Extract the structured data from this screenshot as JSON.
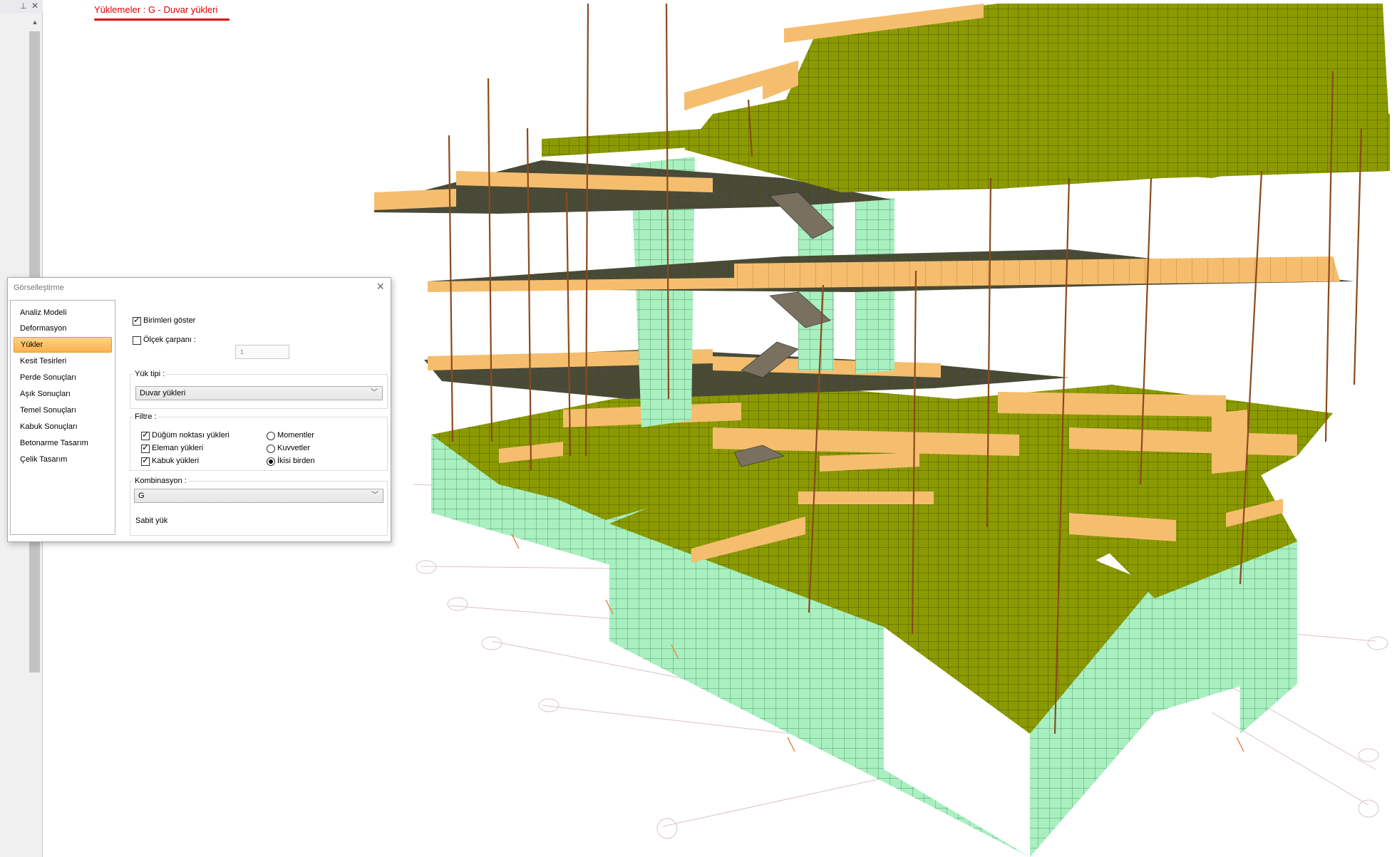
{
  "viewport": {
    "caption": "Yüklemeler : G - Duvar yükleri"
  },
  "colors": {
    "slab": "#8b9a00",
    "wall": "#a8f0c0",
    "beam": "#f5be6e",
    "column": "#8a4a1e",
    "accent_red": "#e00000",
    "nav_active": "#fbb14e"
  },
  "icons": {
    "pin": "pin-icon",
    "close": "close-icon",
    "dropdown": "chevron-down-icon"
  },
  "dialog": {
    "title": "Görselleştirme",
    "nav_items": [
      {
        "label": "Analiz Modeli"
      },
      {
        "label": "Deformasyon"
      },
      {
        "label": "Yükler"
      },
      {
        "label": "Kesit Tesirleri"
      },
      {
        "label": "Perde Sonuçları"
      },
      {
        "label": "Aşık Sonuçları"
      },
      {
        "label": "Temel Sonuçları"
      },
      {
        "label": "Kabuk Sonuçları"
      },
      {
        "label": "Betonarme Tasarım"
      },
      {
        "label": "Çelik Tasarım"
      }
    ],
    "active_nav": "Yükler",
    "show_units_label": "Birimleri göster",
    "show_units_checked": true,
    "scale_label": "Ölçek çarpanı :",
    "scale_checked": false,
    "scale_value": "1",
    "load_type_title": "Yük tipi :",
    "load_type_value": "Duvar yükleri",
    "filter_title": "Filtre :",
    "filter_checks": [
      {
        "label": "Düğüm noktası yükleri",
        "checked": true
      },
      {
        "label": "Eleman yükleri",
        "checked": true
      },
      {
        "label": "Kabuk yükleri",
        "checked": true
      }
    ],
    "filter_radios": [
      {
        "label": "Momentler",
        "checked": false
      },
      {
        "label": "Kuvvetler",
        "checked": false
      },
      {
        "label": "İkisi birden",
        "checked": true
      }
    ],
    "combination_title": "Kombinasyon :",
    "combination_value": "G",
    "combination_desc": "Sabit yük"
  }
}
